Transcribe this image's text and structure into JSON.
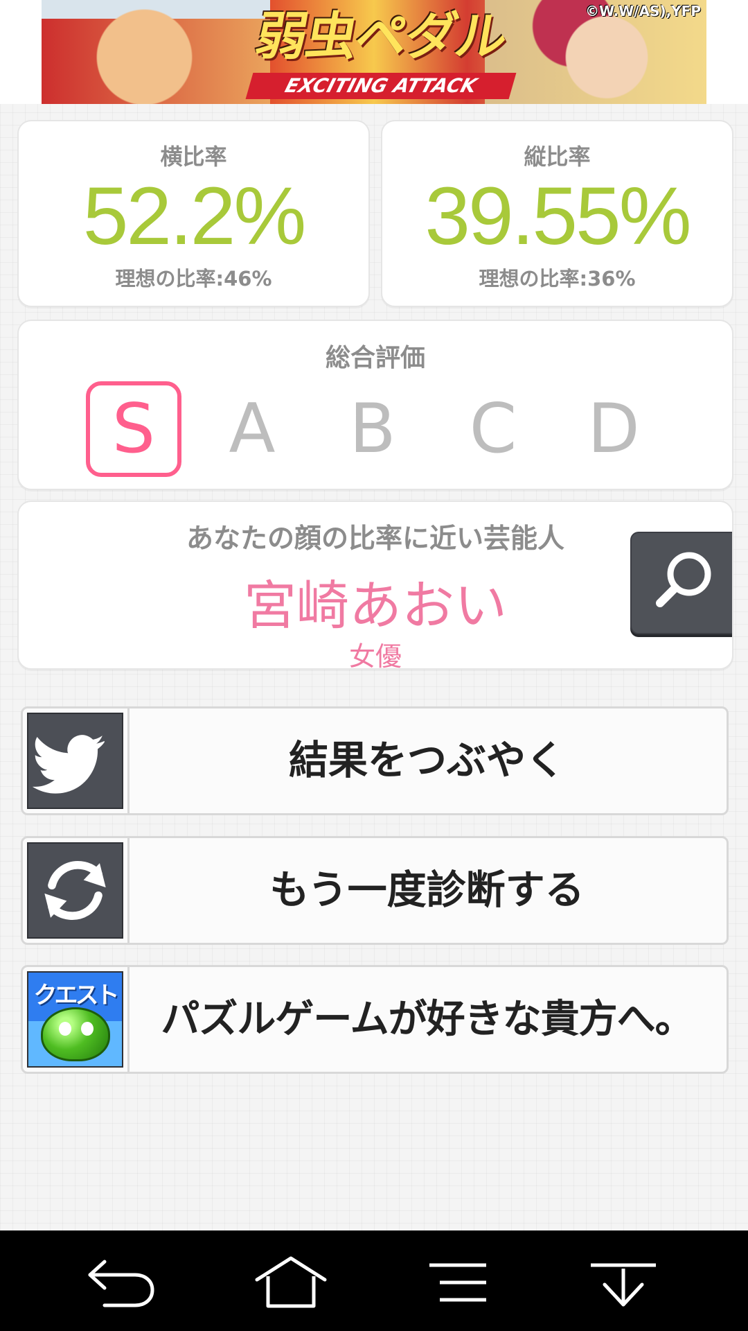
{
  "ad": {
    "title": "弱虫ペダル",
    "subtitle": "EXCITING ATTACK",
    "copyright": "©W.W/AS),YFP"
  },
  "ratios": {
    "horizontal": {
      "label": "横比率",
      "value": "52.2%",
      "ideal": "理想の比率:46%"
    },
    "vertical": {
      "label": "縦比率",
      "value": "39.55%",
      "ideal": "理想の比率:36%"
    }
  },
  "overall": {
    "title": "総合評価",
    "grades": [
      "S",
      "A",
      "B",
      "C",
      "D"
    ],
    "selected": "S"
  },
  "celebrity": {
    "heading": "あなたの顔の比率に近い芸能人",
    "name": "宮崎あおい",
    "profession": "女優"
  },
  "actions": {
    "tweet_label": "結果をつぶやく",
    "retry_label": "もう一度診断する",
    "game_label": "パズルゲームが好きな貴方へ。",
    "game_icon_text": "クエスト"
  },
  "colors": {
    "ratio_value": "#a8c93a",
    "grade_selected": "#ff5f8d",
    "grade_inactive": "#bdbdbd",
    "celebrity_text": "#f07aa2",
    "icon_dark": "#4c4f56",
    "nav_background": "#000000"
  },
  "icons": {
    "search": "magnifier-icon",
    "tweet": "twitter-bird-icon",
    "retry": "refresh-icon",
    "back": "back-arrow-icon",
    "home": "home-icon",
    "menu": "menu-icon",
    "hide": "hide-navigation-icon"
  }
}
